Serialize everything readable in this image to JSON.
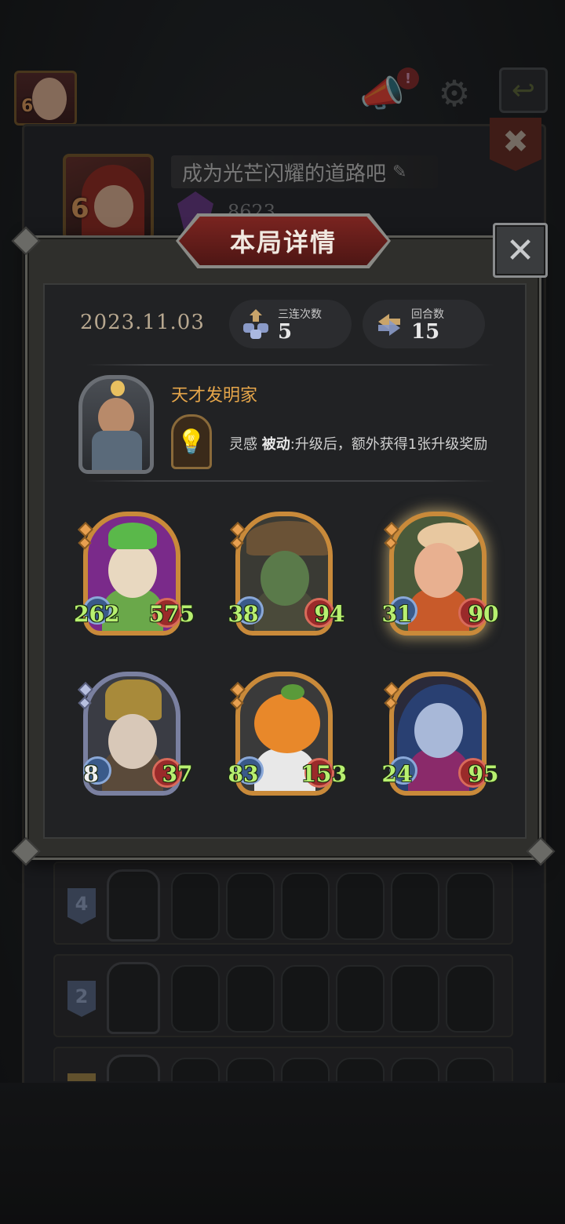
{
  "top_bar": {
    "avatar_level": "6",
    "alert_badge": "!",
    "icons": [
      "megaphone-icon",
      "gear-icon",
      "exit-icon"
    ]
  },
  "profile": {
    "level": "6",
    "motto": "成为光芒闪耀的道路吧",
    "score": "8623"
  },
  "modal": {
    "title": "本局详情",
    "date": "2023.11.03",
    "stats": [
      {
        "label": "三连次数",
        "value": "5"
      },
      {
        "label": "回合数",
        "value": "15"
      }
    ],
    "hero": {
      "name": "天才发明家",
      "skill_name": "灵感",
      "skill_type": "被动",
      "skill_desc": ":升级后，额外获得1张升级奖励"
    },
    "units": [
      {
        "atk": "262",
        "hp": "575",
        "frame": "gold",
        "bg": "#7a2a8a",
        "head": "#e8d8c0",
        "body": "#6aa84a"
      },
      {
        "atk": "38",
        "hp": "94",
        "frame": "gold",
        "bg": "#3a3a34",
        "head": "#5a7a4a",
        "body": "#4a4a3a"
      },
      {
        "atk": "31",
        "hp": "90",
        "frame": "gold-glow",
        "bg": "#4a5a3a",
        "head": "#e8b090",
        "body": "#c85a2a"
      },
      {
        "atk": "8",
        "hp": "37",
        "frame": "silver",
        "bg": "#3a3a3e",
        "head": "#c8a850",
        "body": "#5a4a3a"
      },
      {
        "atk": "83",
        "hp": "153",
        "frame": "gold",
        "bg": "#3a3a3a",
        "head": "#e8882a",
        "body": "#e8e8e8"
      },
      {
        "atk": "24",
        "hp": "95",
        "frame": "gold",
        "bg": "#2a2a3a",
        "head": "#a8b8d8",
        "body": "#8a2a6a"
      }
    ]
  },
  "history_rows": [
    {
      "rank": "4"
    },
    {
      "rank": "2"
    },
    {
      "rank": ""
    }
  ],
  "colors": {
    "accent_gold": "#c98a3a",
    "title_red": "#7a2420",
    "stat_green": "#b8f070",
    "hero_name": "#e6a64a"
  }
}
